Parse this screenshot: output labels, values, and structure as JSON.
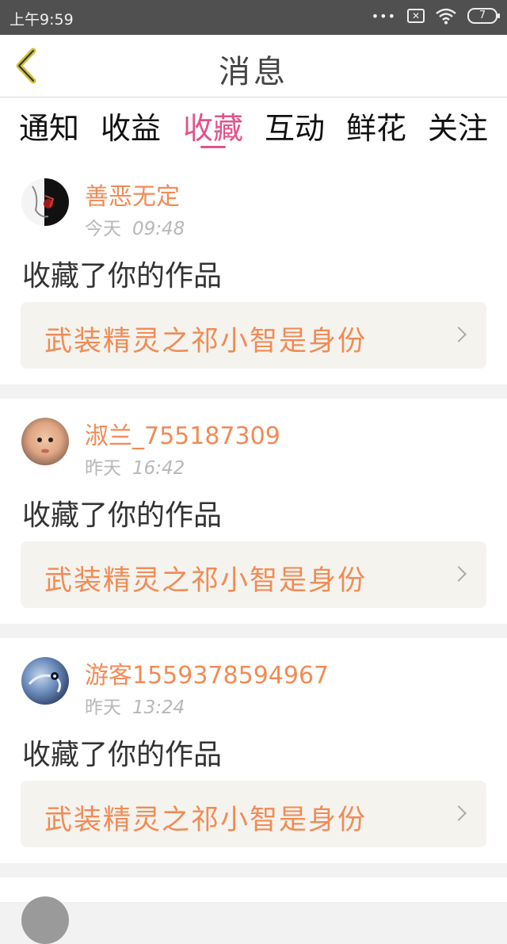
{
  "status_bar": {
    "time": "上午9:59",
    "battery": "7"
  },
  "nav": {
    "title": "消息"
  },
  "tabs": [
    {
      "label": "通知"
    },
    {
      "label": "收益"
    },
    {
      "label": "收藏"
    },
    {
      "label": "互动"
    },
    {
      "label": "鲜花"
    },
    {
      "label": "关注"
    }
  ],
  "active_tab": "收藏",
  "messages": [
    {
      "user": "善恶无定",
      "day": "今天",
      "time": "09:48",
      "action": "收藏了你的作品",
      "work": "武装精灵之祁小智是身份"
    },
    {
      "user": "淑兰_755187309",
      "day": "昨天",
      "time": "16:42",
      "action": "收藏了你的作品",
      "work": "武装精灵之祁小智是身份"
    },
    {
      "user": "游客1559378594967",
      "day": "昨天",
      "time": "13:24",
      "action": "收藏了你的作品",
      "work": "武装精灵之祁小智是身份"
    }
  ],
  "colors": {
    "accent": "#e2538a",
    "username": "#f18b55",
    "status_bar": "#505050"
  }
}
